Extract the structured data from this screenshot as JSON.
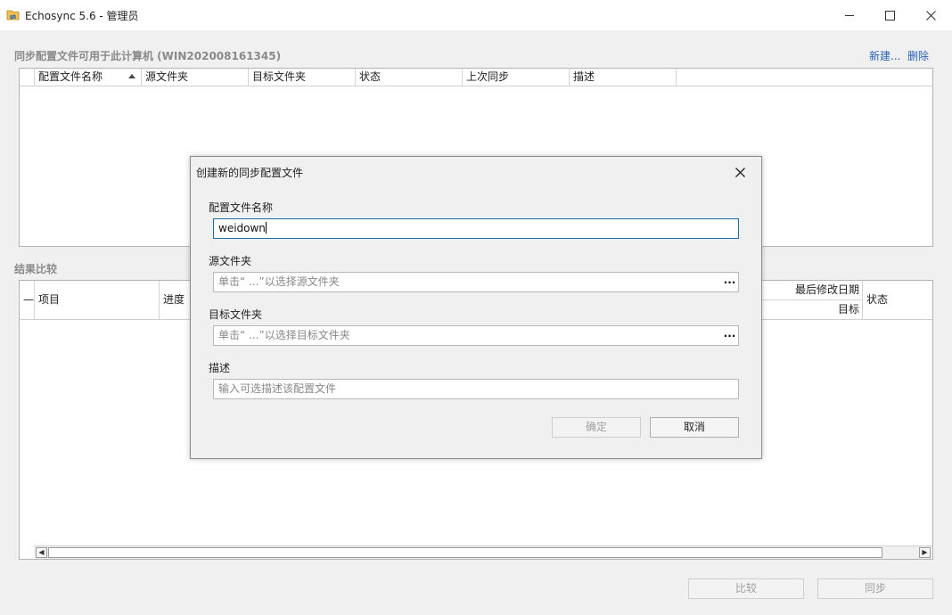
{
  "window": {
    "title": "Echosync 5.6 - 管理员",
    "icon": "sync-folder-icon"
  },
  "profiles": {
    "section_title": "同步配置文件可用于此计算机 (WIN202008161345)",
    "new_link": "新建...",
    "delete_link": "删除",
    "columns": [
      "配置文件名称",
      "源文件夹",
      "目标文件夹",
      "状态",
      "上次同步",
      "描述"
    ],
    "sorted_column": "配置文件名称",
    "rows": []
  },
  "results": {
    "section_title": "结果比较",
    "columns": {
      "item": "项目",
      "progress": "进度",
      "last_modified": "最后修改日期",
      "target": "目标",
      "status": "状态"
    },
    "rows": []
  },
  "footer": {
    "compare_button": "比较",
    "sync_button": "同步"
  },
  "dialog": {
    "title": "创建新的同步配置文件",
    "name_label": "配置文件名称",
    "name_value": "weidown",
    "source_label": "源文件夹",
    "source_placeholder": "单击“ ...”以选择源文件夹",
    "target_label": "目标文件夹",
    "target_placeholder": "单击“ ...”以选择目标文件夹",
    "desc_label": "描述",
    "desc_placeholder": "输入可选描述该配置文件",
    "browse_label": "...",
    "ok_button": "确定",
    "cancel_button": "取消"
  },
  "colors": {
    "link": "#2a62b8",
    "active_border": "#1c6ea4"
  }
}
